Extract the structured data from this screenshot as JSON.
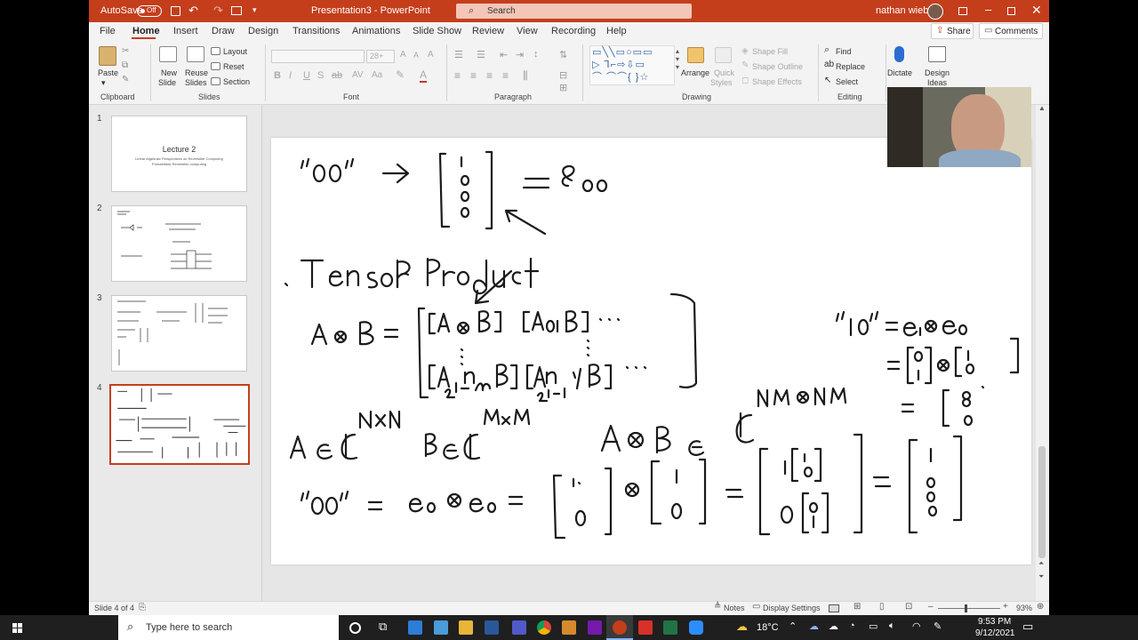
{
  "app": {
    "autosave_label": "AutoSave",
    "autosave_state": "Off",
    "doc_title": "Presentation3 - PowerPoint",
    "search_placeholder": "Search",
    "user_name": "nathan wiebe"
  },
  "tabs": [
    "File",
    "Home",
    "Insert",
    "Draw",
    "Design",
    "Transitions",
    "Animations",
    "Slide Show",
    "Review",
    "View",
    "Recording",
    "Help"
  ],
  "active_tab": "Home",
  "share_label": "Share",
  "comments_label": "Comments",
  "ribbon": {
    "clipboard": {
      "paste": "Paste",
      "label": "Clipboard"
    },
    "slides": {
      "new_slide": "New",
      "new_slide2": "Slide",
      "reuse": "Reuse",
      "reuse2": "Slides",
      "layout": "Layout",
      "reset": "Reset",
      "section": "Section",
      "label": "Slides"
    },
    "font": {
      "size": "28+",
      "label": "Font",
      "bold": "B",
      "italic": "I",
      "underline": "U",
      "strike": "S"
    },
    "paragraph": {
      "label": "Paragraph"
    },
    "drawing": {
      "arrange": "Arrange",
      "quick_styles": "Quick",
      "quick_styles2": "Styles",
      "shape_fill": "Shape Fill",
      "shape_outline": "Shape Outline",
      "shape_effects": "Shape Effects",
      "label": "Drawing"
    },
    "editing": {
      "find": "Find",
      "replace": "Replace",
      "select": "Select",
      "label": "Editing"
    },
    "voice": {
      "dictate": "Dictate"
    },
    "designer": {
      "design_ideas": "Design",
      "design_ideas2": "Ideas"
    }
  },
  "slides": [
    {
      "num": "1",
      "title": "Lecture 2",
      "line1": "Linear Algebraic Perspectives on Reversible Computing",
      "line2": "Probabilistic Reversible computing"
    },
    {
      "num": "2"
    },
    {
      "num": "3"
    },
    {
      "num": "4"
    }
  ],
  "status": {
    "slide_info": "Slide 4 of 4",
    "notes": "Notes",
    "display_settings": "Display Settings",
    "zoom": "93%"
  },
  "taskbar": {
    "search_placeholder": "Type here to search",
    "temperature": "18°C",
    "time": "9:53 PM",
    "date": "9/12/2021"
  },
  "colors": {
    "accent": "#c43e1c",
    "taskbar": "#1f1f1f",
    "ribbon": "#f3f3f3"
  }
}
